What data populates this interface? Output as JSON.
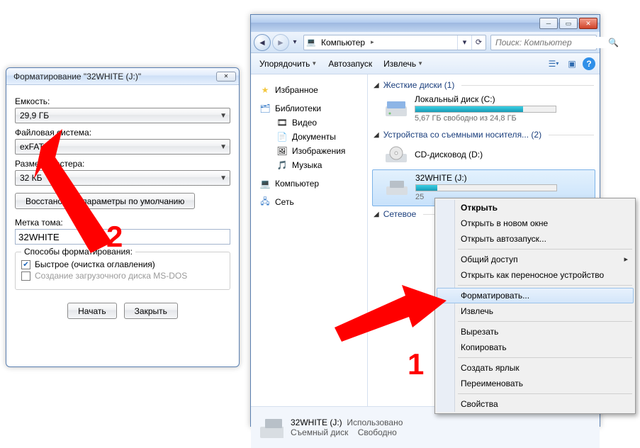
{
  "explorer": {
    "address_label": "Компьютер",
    "search_placeholder": "Поиск: Компьютер",
    "toolbar": {
      "organize": "Упорядочить",
      "autorun": "Автозапуск",
      "eject": "Извлечь"
    },
    "sidebar": {
      "favorites": "Избранное",
      "libraries": "Библиотеки",
      "video": "Видео",
      "documents": "Документы",
      "images": "Изображения",
      "music": "Музыка",
      "computer": "Компьютер",
      "network": "Сеть"
    },
    "groups": {
      "hdd": "Жесткие диски (1)",
      "removable": "Устройства со съемными носителя... (2)",
      "net": "Сетевое"
    },
    "drives": {
      "local_c": "Локальный диск (C:)",
      "c_free": "5,67 ГБ свободно из 24,8 ГБ",
      "cddvd": "CD-дисковод (D:)",
      "usb": "32WHITE (J:)"
    },
    "status": {
      "name": "32WHITE (J:)",
      "type": "Съемный диск",
      "used_label": "Использовано",
      "free_label": "Свободно"
    }
  },
  "context_menu": {
    "open": "Открыть",
    "open_new": "Открыть в новом окне",
    "autoplay": "Открыть автозапуск...",
    "share": "Общий доступ",
    "portable": "Открыть как переносное устройство",
    "format": "Форматировать...",
    "eject": "Извлечь",
    "cut": "Вырезать",
    "copy": "Копировать",
    "shortcut": "Создать ярлык",
    "rename": "Переименовать",
    "properties": "Свойства"
  },
  "format_dialog": {
    "title": "Форматирование \"32WHITE (J:)\"",
    "capacity_label": "Емкость:",
    "capacity_value": "29,9 ГБ",
    "fs_label": "Файловая система:",
    "fs_value": "exFAT",
    "cluster_label": "Размер кластера:",
    "cluster_value": "32 КБ",
    "restore_btn": "Восстановить параметры по умолчанию",
    "volume_label": "Метка тома:",
    "volume_value": "32WHITE",
    "methods_legend": "Способы форматирования:",
    "quick": "Быстрое (очистка оглавления)",
    "msdos": "Создание загрузочного диска MS-DOS",
    "start": "Начать",
    "close": "Закрыть"
  },
  "annotations": {
    "one": "1",
    "two": "2"
  }
}
